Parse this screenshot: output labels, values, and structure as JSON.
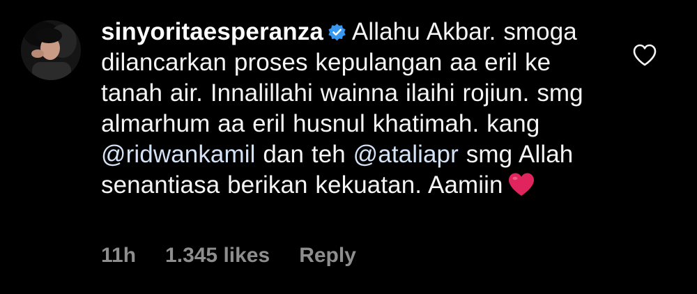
{
  "comment": {
    "username": "sinyoritaesperanza",
    "verified": true,
    "text_parts": {
      "part1": "Allahu Akbar. smoga dilancarkan proses kepulangan aa eril ke tanah air. Innalillahi wainna ilaihi rojiun. smg almarhum aa eril husnul khatimah. kang",
      "mention1": "@ridwankamil",
      "part2": "dan teh",
      "mention2": "@ataliapr",
      "part3": "smg Allah senantiasa berikan kekuatan. Aamiin"
    },
    "emoji": "heart-emoji",
    "time": "11h",
    "likes": "1.345 likes",
    "reply_label": "Reply"
  },
  "icons": {
    "verified": "verified-badge-icon",
    "like": "heart-outline-icon"
  },
  "colors": {
    "background": "#000000",
    "text": "#f5f5f5",
    "mention": "#d4e3f7",
    "meta": "#8e8e8e",
    "verified_badge": "#3897f0",
    "heart": "#e0245e"
  }
}
